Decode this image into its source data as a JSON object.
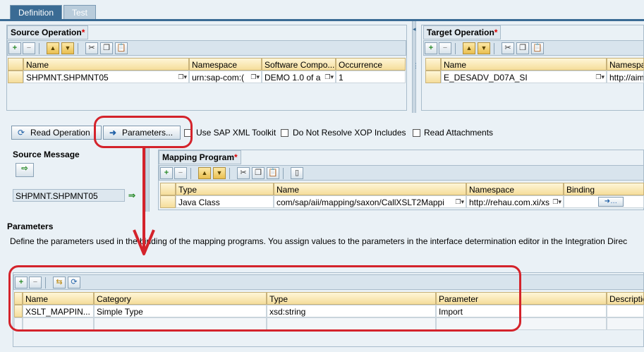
{
  "tabs": [
    {
      "label": "Definition",
      "active": true
    },
    {
      "label": "Test",
      "active": false
    }
  ],
  "source_operation": {
    "title": "Source Operation",
    "required_mark": "*",
    "columns": [
      "Name",
      "Namespace",
      "Software Compo...",
      "Occurrence"
    ],
    "row": {
      "name": "SHPMNT.SHPMNT05",
      "namespace": "urn:sap-com:(",
      "software_component": "DEMO 1.0 of a",
      "occurrence": "1"
    }
  },
  "target_operation": {
    "title": "Target Operation",
    "required_mark": "*",
    "columns": [
      "Name",
      "Namespa"
    ],
    "row": {
      "name": "E_DESADV_D07A_SI",
      "namespace": "http://aimt"
    }
  },
  "actions": {
    "read_operation": "Read Operation",
    "parameters": "Parameters...",
    "use_sap_xml_toolkit": "Use SAP XML Toolkit",
    "do_not_resolve_xop": "Do Not Resolve XOP Includes",
    "read_attachments": "Read Attachments"
  },
  "source_message": {
    "title": "Source Message",
    "value": "SHPMNT.SHPMNT05"
  },
  "mapping_program": {
    "title": "Mapping Program",
    "required_mark": "*",
    "columns": [
      "Type",
      "Name",
      "Namespace",
      "Binding"
    ],
    "row": {
      "type": "Java Class",
      "name": "com/sap/aii/mapping/saxon/CallXSLT2Mappi",
      "namespace": "http://rehau.com.xi/xs",
      "binding": ""
    }
  },
  "parameters": {
    "title": "Parameters",
    "description": "Define the parameters used in the binding of the mapping programs. You assign values to the parameters in the interface determination editor in the Integration Direc",
    "columns": [
      "Name",
      "Category",
      "Type",
      "Parameter",
      "Descriptio"
    ],
    "rows": [
      {
        "name": "XSLT_MAPPIN...",
        "category": "Simple Type",
        "type": "xsd:string",
        "parameter": "Import",
        "description": ""
      }
    ]
  },
  "colors": {
    "tab_active": "#3a6b94",
    "annotation_red": "#d4232b",
    "header_gold": "#f5dd9a"
  }
}
